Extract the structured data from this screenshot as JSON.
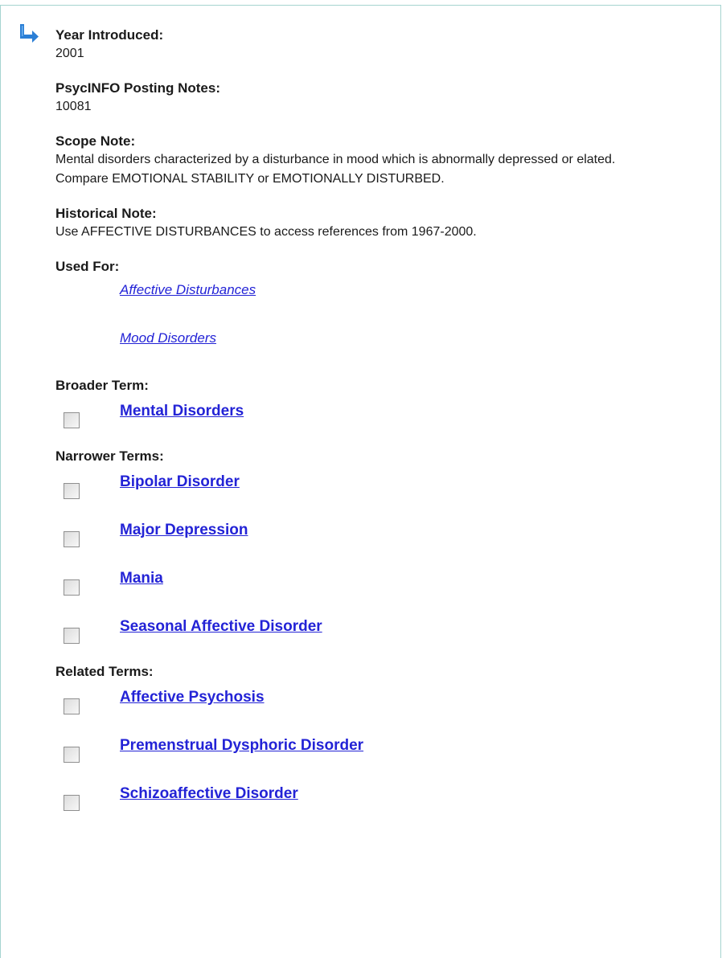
{
  "fields": {
    "year_introduced": {
      "label": "Year Introduced:",
      "value": "2001"
    },
    "posting_notes": {
      "label": "PsycINFO Posting Notes:",
      "value": "10081"
    },
    "scope_note": {
      "label": "Scope Note:",
      "value": "Mental disorders characterized by a disturbance in mood which is abnormally depressed or elated. Compare EMOTIONAL STABILITY or EMOTIONALLY DISTURBED."
    },
    "historical_note": {
      "label": "Historical Note:",
      "value": "Use AFFECTIVE DISTURBANCES to access references from 1967-2000."
    }
  },
  "used_for": {
    "label": "Used For:",
    "items": [
      "Affective Disturbances",
      "Mood Disorders"
    ]
  },
  "broader": {
    "label": "Broader Term:",
    "items": [
      "Mental Disorders"
    ]
  },
  "narrower": {
    "label": "Narrower Terms:",
    "items": [
      "Bipolar Disorder",
      "Major Depression",
      "Mania",
      "Seasonal Affective Disorder"
    ]
  },
  "related": {
    "label": "Related Terms:",
    "items": [
      "Affective Psychosis",
      "Premenstrual Dysphoric Disorder",
      "Schizoaffective Disorder"
    ]
  },
  "colors": {
    "link": "#2323d6",
    "arrow": "#2b7fd6",
    "border": "#a6d4d0"
  },
  "icons": {
    "indicator": "arrow-right-turn-icon",
    "checkbox": "checkbox-icon"
  }
}
